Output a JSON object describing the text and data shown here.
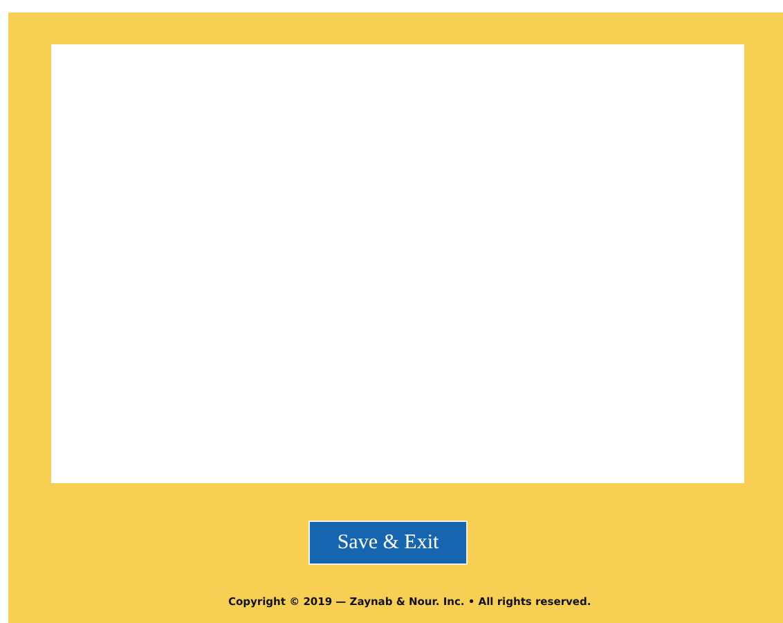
{
  "content_panel": {
    "kind": "blank"
  },
  "button": {
    "label": "Save & Exit"
  },
  "footer": {
    "copyright": "Copyright © 2019 — Zaynab & Nour. Inc. • All rights reserved."
  }
}
